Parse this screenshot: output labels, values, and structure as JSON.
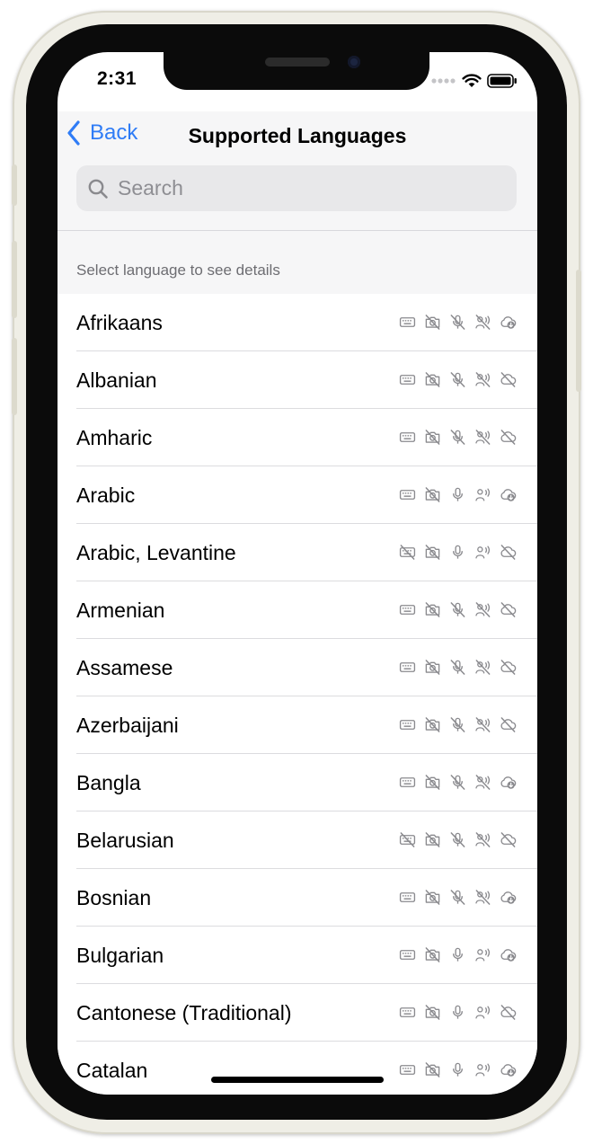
{
  "status_bar": {
    "time": "2:31"
  },
  "nav": {
    "back_label": "Back",
    "title": "Supported Languages"
  },
  "search": {
    "placeholder": "Search",
    "value": ""
  },
  "section_header": "Select language to see details",
  "feature_icons": [
    "keyboard-icon",
    "camera-icon",
    "microphone-icon",
    "speech-icon",
    "cloud-download-icon"
  ],
  "languages": [
    {
      "name": "Afrikaans",
      "keyboard": true,
      "camera": false,
      "mic": false,
      "speech": false,
      "download": true
    },
    {
      "name": "Albanian",
      "keyboard": true,
      "camera": false,
      "mic": false,
      "speech": false,
      "download": false
    },
    {
      "name": "Amharic",
      "keyboard": true,
      "camera": false,
      "mic": false,
      "speech": false,
      "download": false
    },
    {
      "name": "Arabic",
      "keyboard": true,
      "camera": false,
      "mic": true,
      "speech": true,
      "download": true
    },
    {
      "name": "Arabic, Levantine",
      "keyboard": false,
      "camera": false,
      "mic": true,
      "speech": true,
      "download": false
    },
    {
      "name": "Armenian",
      "keyboard": true,
      "camera": false,
      "mic": false,
      "speech": false,
      "download": false
    },
    {
      "name": "Assamese",
      "keyboard": true,
      "camera": false,
      "mic": false,
      "speech": false,
      "download": false
    },
    {
      "name": "Azerbaijani",
      "keyboard": true,
      "camera": false,
      "mic": false,
      "speech": false,
      "download": false
    },
    {
      "name": "Bangla",
      "keyboard": true,
      "camera": false,
      "mic": false,
      "speech": false,
      "download": true
    },
    {
      "name": "Belarusian",
      "keyboard": false,
      "camera": false,
      "mic": false,
      "speech": false,
      "download": false
    },
    {
      "name": "Bosnian",
      "keyboard": true,
      "camera": false,
      "mic": false,
      "speech": false,
      "download": true
    },
    {
      "name": "Bulgarian",
      "keyboard": true,
      "camera": false,
      "mic": true,
      "speech": true,
      "download": true
    },
    {
      "name": "Cantonese (Traditional)",
      "keyboard": true,
      "camera": false,
      "mic": true,
      "speech": true,
      "download": false
    },
    {
      "name": "Catalan",
      "keyboard": true,
      "camera": false,
      "mic": true,
      "speech": true,
      "download": true
    }
  ],
  "colors": {
    "accent": "#2f7cf6",
    "icon": "#8a8a8e",
    "nav_bg": "#f6f6f7",
    "frame": "#efeee6"
  }
}
